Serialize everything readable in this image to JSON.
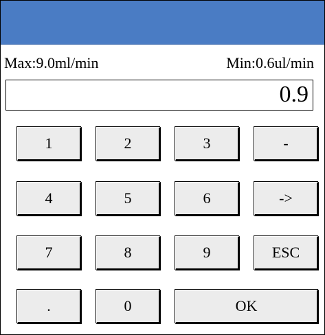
{
  "limits": {
    "max": "Max:9.0ml/min",
    "min": "Min:0.6ul/min"
  },
  "display": {
    "value": "0.9"
  },
  "keys": {
    "k1": "1",
    "k2": "2",
    "k3": "3",
    "minus": "-",
    "k4": "4",
    "k5": "5",
    "k6": "6",
    "arrow": "->",
    "k7": "7",
    "k8": "8",
    "k9": "9",
    "esc": "ESC",
    "dot": ".",
    "k0": "0",
    "ok": "OK"
  },
  "colors": {
    "titlebar": "#4a7cc4",
    "key_face": "#ececec"
  }
}
